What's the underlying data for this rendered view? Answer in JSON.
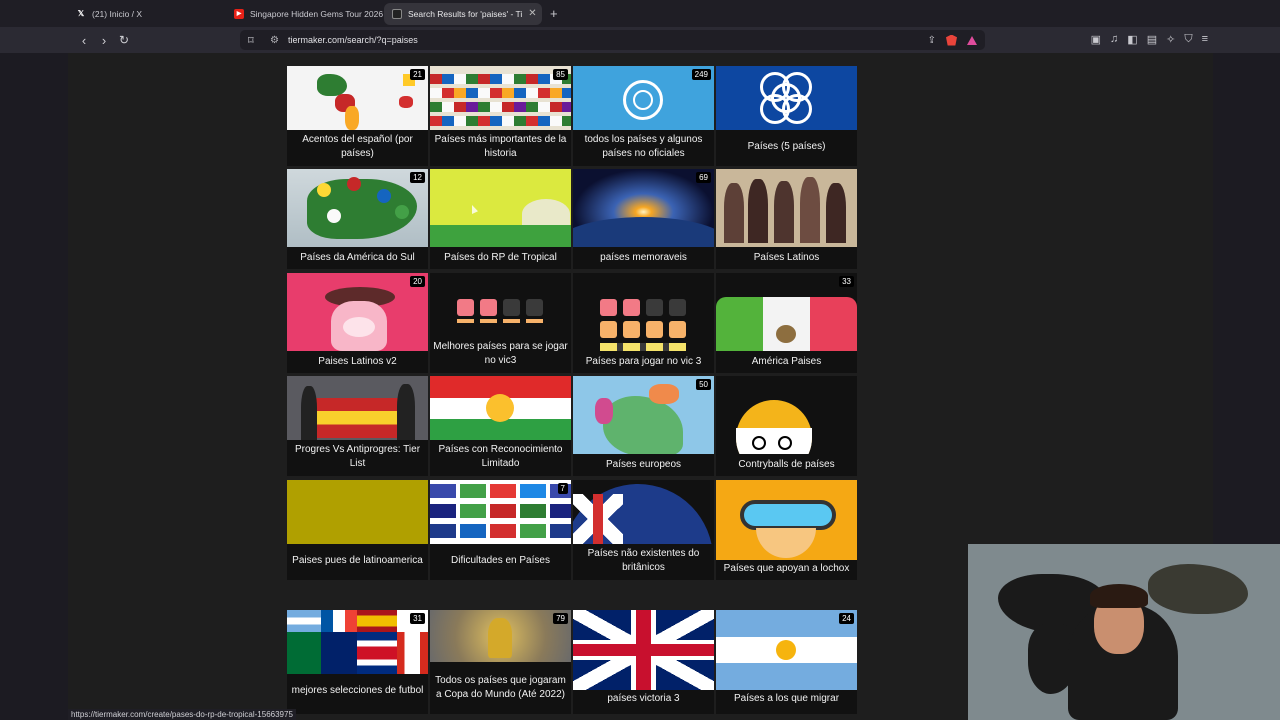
{
  "tabs": [
    {
      "label": "(21) Inicio / X",
      "icon": "x-logo-icon"
    },
    {
      "label": "Singapore Hidden Gems Tour 2026",
      "icon": "youtube-icon"
    },
    {
      "label": "Search Results for 'paises' - Ti",
      "icon": "tiermaker-icon"
    }
  ],
  "address_bar": {
    "url": "tiermaker.com/search/?q=paises"
  },
  "cards": [
    {
      "title": "Acentos del español (por países)",
      "count": "21"
    },
    {
      "title": "Países más importantes de la historia",
      "count": "85"
    },
    {
      "title": "todos los países y algunos países no oficiales",
      "count": "249"
    },
    {
      "title": "Países (5 países)",
      "count": ""
    },
    {
      "title": "Países da América do Sul",
      "count": "12"
    },
    {
      "title": "Países do RP de Tropical",
      "count": ""
    },
    {
      "title": "países memoraveis",
      "count": "69"
    },
    {
      "title": "Países Latinos",
      "count": ""
    },
    {
      "title": "Paises Latinos v2",
      "count": "20"
    },
    {
      "title": "Melhores países para se jogar no vic3",
      "count": ""
    },
    {
      "title": "Países para jogar no vic 3",
      "count": ""
    },
    {
      "title": "América Paises",
      "count": "33"
    },
    {
      "title": "Progres Vs Antiprogres: Tier List",
      "count": ""
    },
    {
      "title": "Países con Reconocimiento Limitado",
      "count": ""
    },
    {
      "title": "Países europeos",
      "count": "50"
    },
    {
      "title": "Contryballs de países",
      "count": ""
    },
    {
      "title": "Paises pues de latinoamerica",
      "count": ""
    },
    {
      "title": "Dificultades en Países",
      "count": "7"
    },
    {
      "title": "Países não existentes do britânicos",
      "count": ""
    },
    {
      "title": "Países que apoyan a lochox",
      "count": ""
    },
    {
      "title": "mejores selecciones de futbol",
      "count": "31"
    },
    {
      "title": "Todos os países que jogaram a Copa do Mundo (Até 2022)",
      "count": "79"
    },
    {
      "title": "países victoria 3",
      "count": ""
    },
    {
      "title": "Países a los que migrar",
      "count": "24"
    }
  ],
  "status_bar": {
    "url": "https://tiermaker.com/create/pases-do-rp-de-tropical-15663975"
  }
}
